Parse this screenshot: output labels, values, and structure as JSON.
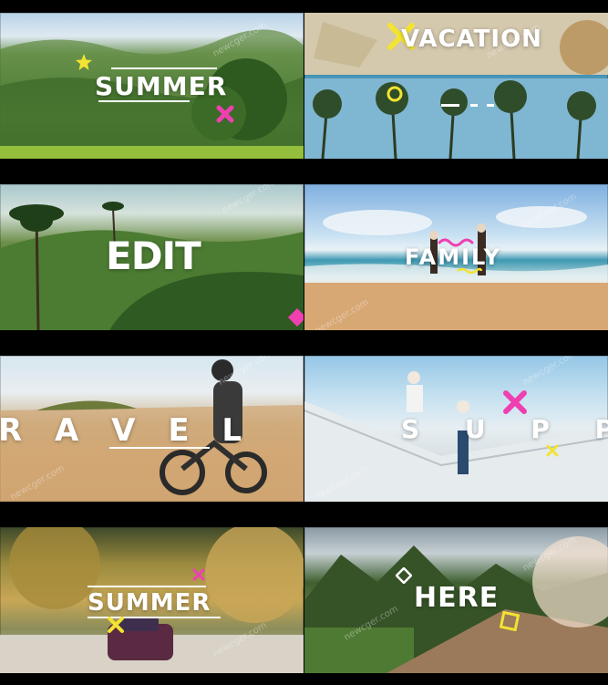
{
  "tiles": [
    {
      "label": "SUMMER"
    },
    {
      "label": "VACATION"
    },
    {
      "label": "EDIT"
    },
    {
      "label": "FAMILY"
    },
    {
      "label": "R A V E L"
    },
    {
      "label": "S U P P O"
    },
    {
      "label": "SUMMER"
    },
    {
      "label": "HERE"
    }
  ],
  "watermark": "newcger.com",
  "colors": {
    "accent_pink": "#ef3fb1",
    "accent_yellow": "#f3e332",
    "background": "#000000"
  }
}
